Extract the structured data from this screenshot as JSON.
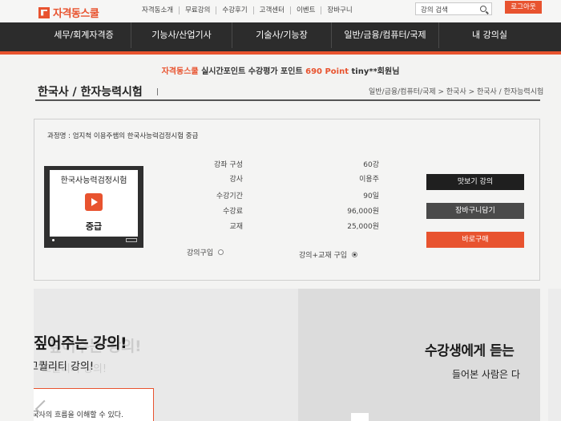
{
  "brand": {
    "name": "자격동스쿨"
  },
  "top_nav": [
    "자격동소개",
    "무료강의",
    "수강후기",
    "고객센터",
    "이벤트",
    "장바구니"
  ],
  "search": {
    "placeholder": "강의 검색"
  },
  "login_label": "로그아웃",
  "main_nav": [
    "세무/회계자격증",
    "기능사/산업기사",
    "기술사/기능장",
    "일반/금융/컴퓨터/국제",
    "내 강의실"
  ],
  "notice": {
    "brand": "자격동스쿨",
    "text1": " 실시간포인트 수강평가 포인트 ",
    "points": "690 Point",
    "user": " tiny**회원님"
  },
  "page": {
    "title": "한국사 / 한자능력시험",
    "breadcrumb": "일반/금융/컴퓨터/국제 > 한국사 > 한국사 / 한자능력시험"
  },
  "course": {
    "name_label": "과정명 : 엄지척 이용주쌤의 한국사능력검정시험 중급",
    "thumb_title": "한국사능력검정시험",
    "thumb_level": "중급",
    "info": [
      {
        "label": "강좌 구성",
        "value": "60강"
      },
      {
        "label": "강사",
        "value": "이용주"
      },
      {
        "label": "수강기간",
        "value": "90일"
      },
      {
        "label": "수강료",
        "value": "96,000원"
      },
      {
        "label": "교재",
        "value": "25,000원"
      }
    ],
    "buy_options": [
      {
        "label": "강의구입",
        "selected": false
      },
      {
        "label": "강의+교재 구입",
        "selected": true
      }
    ],
    "buttons": {
      "preview": "맛보기 강의",
      "cart": "장바구니담기",
      "buy": "바로구매"
    }
  },
  "promo": {
    "left_title": "짚어주는 강의!",
    "left_sub": "고퀄리티 강의!",
    "left_small": "한국사의 흐름을 이해할 수 있다.",
    "right_title": "수강생에게 듣는",
    "right_sub": "들어본 사람은 다"
  },
  "colors": {
    "accent": "#e8532f",
    "nav_bg": "#2c2c2c",
    "dark_button": "#1f1f1f",
    "gray_button": "#4a4a4a"
  }
}
